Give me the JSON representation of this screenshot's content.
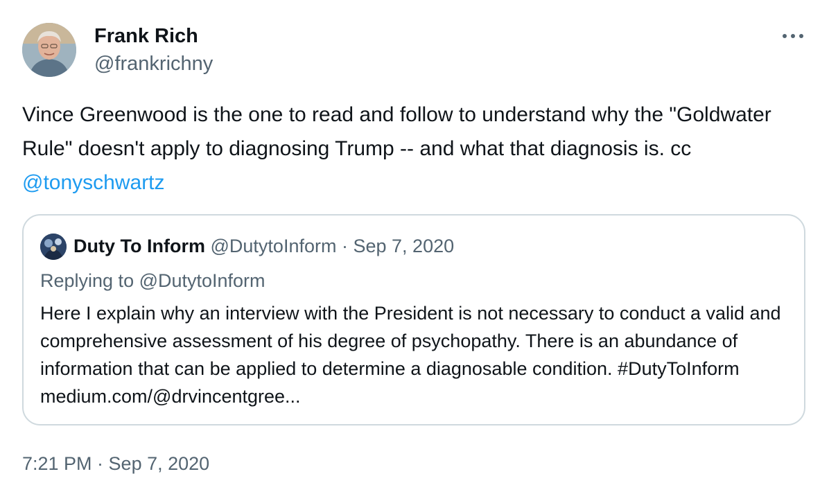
{
  "author": {
    "name": "Frank Rich",
    "handle": "@frankrichny"
  },
  "tweet": {
    "text": "Vince Greenwood is the one to read and follow to understand why the \"Goldwater Rule\" doesn't apply to diagnosing Trump -- and what that diagnosis is. cc ",
    "mention": "@tonyschwartz",
    "timestamp": "7:21 PM · Sep 7, 2020"
  },
  "quoted_tweet": {
    "name": "Duty To Inform",
    "handle": "@DutytoInform",
    "separator": "·",
    "date": "Sep 7, 2020",
    "replying_to": "Replying to @DutytoInform",
    "text": "Here I explain why an interview with the President is not necessary to conduct a valid and comprehensive assessment of his degree of psychopathy. There is an abundance of information that can be applied to determine a diagnosable condition. #DutyToInform medium.com/@drvincentgree..."
  },
  "icons": {
    "more": "more-horizontal-icon"
  },
  "colors": {
    "text": "#0f1419",
    "secondary": "#536471",
    "link": "#1d9bf0",
    "border": "#cfd9de"
  }
}
